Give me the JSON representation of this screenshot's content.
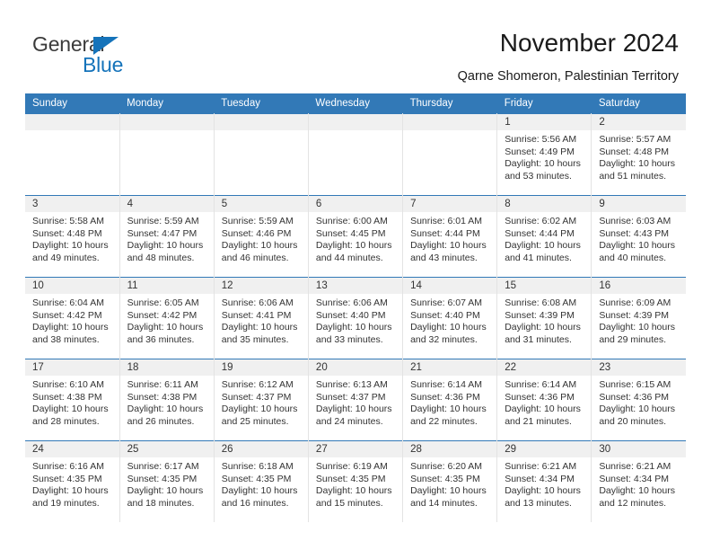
{
  "brand": {
    "name_top": "General",
    "name_bottom": "Blue",
    "accent_color": "#1573ba",
    "triangle_icon": "triangle-icon"
  },
  "header": {
    "title": "November 2024",
    "subtitle": "Qarne Shomeron, Palestinian Territory"
  },
  "calendar": {
    "header_bg": "#3279b7",
    "daynum_bg": "#f0f0f0",
    "weekday_headers": [
      "Sunday",
      "Monday",
      "Tuesday",
      "Wednesday",
      "Thursday",
      "Friday",
      "Saturday"
    ],
    "weeks": [
      [
        {
          "day": "",
          "empty": true
        },
        {
          "day": "",
          "empty": true
        },
        {
          "day": "",
          "empty": true
        },
        {
          "day": "",
          "empty": true
        },
        {
          "day": "",
          "empty": true
        },
        {
          "day": "1",
          "sunrise": "Sunrise: 5:56 AM",
          "sunset": "Sunset: 4:49 PM",
          "daylight1": "Daylight: 10 hours",
          "daylight2": "and 53 minutes."
        },
        {
          "day": "2",
          "sunrise": "Sunrise: 5:57 AM",
          "sunset": "Sunset: 4:48 PM",
          "daylight1": "Daylight: 10 hours",
          "daylight2": "and 51 minutes."
        }
      ],
      [
        {
          "day": "3",
          "sunrise": "Sunrise: 5:58 AM",
          "sunset": "Sunset: 4:48 PM",
          "daylight1": "Daylight: 10 hours",
          "daylight2": "and 49 minutes."
        },
        {
          "day": "4",
          "sunrise": "Sunrise: 5:59 AM",
          "sunset": "Sunset: 4:47 PM",
          "daylight1": "Daylight: 10 hours",
          "daylight2": "and 48 minutes."
        },
        {
          "day": "5",
          "sunrise": "Sunrise: 5:59 AM",
          "sunset": "Sunset: 4:46 PM",
          "daylight1": "Daylight: 10 hours",
          "daylight2": "and 46 minutes."
        },
        {
          "day": "6",
          "sunrise": "Sunrise: 6:00 AM",
          "sunset": "Sunset: 4:45 PM",
          "daylight1": "Daylight: 10 hours",
          "daylight2": "and 44 minutes."
        },
        {
          "day": "7",
          "sunrise": "Sunrise: 6:01 AM",
          "sunset": "Sunset: 4:44 PM",
          "daylight1": "Daylight: 10 hours",
          "daylight2": "and 43 minutes."
        },
        {
          "day": "8",
          "sunrise": "Sunrise: 6:02 AM",
          "sunset": "Sunset: 4:44 PM",
          "daylight1": "Daylight: 10 hours",
          "daylight2": "and 41 minutes."
        },
        {
          "day": "9",
          "sunrise": "Sunrise: 6:03 AM",
          "sunset": "Sunset: 4:43 PM",
          "daylight1": "Daylight: 10 hours",
          "daylight2": "and 40 minutes."
        }
      ],
      [
        {
          "day": "10",
          "sunrise": "Sunrise: 6:04 AM",
          "sunset": "Sunset: 4:42 PM",
          "daylight1": "Daylight: 10 hours",
          "daylight2": "and 38 minutes."
        },
        {
          "day": "11",
          "sunrise": "Sunrise: 6:05 AM",
          "sunset": "Sunset: 4:42 PM",
          "daylight1": "Daylight: 10 hours",
          "daylight2": "and 36 minutes."
        },
        {
          "day": "12",
          "sunrise": "Sunrise: 6:06 AM",
          "sunset": "Sunset: 4:41 PM",
          "daylight1": "Daylight: 10 hours",
          "daylight2": "and 35 minutes."
        },
        {
          "day": "13",
          "sunrise": "Sunrise: 6:06 AM",
          "sunset": "Sunset: 4:40 PM",
          "daylight1": "Daylight: 10 hours",
          "daylight2": "and 33 minutes."
        },
        {
          "day": "14",
          "sunrise": "Sunrise: 6:07 AM",
          "sunset": "Sunset: 4:40 PM",
          "daylight1": "Daylight: 10 hours",
          "daylight2": "and 32 minutes."
        },
        {
          "day": "15",
          "sunrise": "Sunrise: 6:08 AM",
          "sunset": "Sunset: 4:39 PM",
          "daylight1": "Daylight: 10 hours",
          "daylight2": "and 31 minutes."
        },
        {
          "day": "16",
          "sunrise": "Sunrise: 6:09 AM",
          "sunset": "Sunset: 4:39 PM",
          "daylight1": "Daylight: 10 hours",
          "daylight2": "and 29 minutes."
        }
      ],
      [
        {
          "day": "17",
          "sunrise": "Sunrise: 6:10 AM",
          "sunset": "Sunset: 4:38 PM",
          "daylight1": "Daylight: 10 hours",
          "daylight2": "and 28 minutes."
        },
        {
          "day": "18",
          "sunrise": "Sunrise: 6:11 AM",
          "sunset": "Sunset: 4:38 PM",
          "daylight1": "Daylight: 10 hours",
          "daylight2": "and 26 minutes."
        },
        {
          "day": "19",
          "sunrise": "Sunrise: 6:12 AM",
          "sunset": "Sunset: 4:37 PM",
          "daylight1": "Daylight: 10 hours",
          "daylight2": "and 25 minutes."
        },
        {
          "day": "20",
          "sunrise": "Sunrise: 6:13 AM",
          "sunset": "Sunset: 4:37 PM",
          "daylight1": "Daylight: 10 hours",
          "daylight2": "and 24 minutes."
        },
        {
          "day": "21",
          "sunrise": "Sunrise: 6:14 AM",
          "sunset": "Sunset: 4:36 PM",
          "daylight1": "Daylight: 10 hours",
          "daylight2": "and 22 minutes."
        },
        {
          "day": "22",
          "sunrise": "Sunrise: 6:14 AM",
          "sunset": "Sunset: 4:36 PM",
          "daylight1": "Daylight: 10 hours",
          "daylight2": "and 21 minutes."
        },
        {
          "day": "23",
          "sunrise": "Sunrise: 6:15 AM",
          "sunset": "Sunset: 4:36 PM",
          "daylight1": "Daylight: 10 hours",
          "daylight2": "and 20 minutes."
        }
      ],
      [
        {
          "day": "24",
          "sunrise": "Sunrise: 6:16 AM",
          "sunset": "Sunset: 4:35 PM",
          "daylight1": "Daylight: 10 hours",
          "daylight2": "and 19 minutes."
        },
        {
          "day": "25",
          "sunrise": "Sunrise: 6:17 AM",
          "sunset": "Sunset: 4:35 PM",
          "daylight1": "Daylight: 10 hours",
          "daylight2": "and 18 minutes."
        },
        {
          "day": "26",
          "sunrise": "Sunrise: 6:18 AM",
          "sunset": "Sunset: 4:35 PM",
          "daylight1": "Daylight: 10 hours",
          "daylight2": "and 16 minutes."
        },
        {
          "day": "27",
          "sunrise": "Sunrise: 6:19 AM",
          "sunset": "Sunset: 4:35 PM",
          "daylight1": "Daylight: 10 hours",
          "daylight2": "and 15 minutes."
        },
        {
          "day": "28",
          "sunrise": "Sunrise: 6:20 AM",
          "sunset": "Sunset: 4:35 PM",
          "daylight1": "Daylight: 10 hours",
          "daylight2": "and 14 minutes."
        },
        {
          "day": "29",
          "sunrise": "Sunrise: 6:21 AM",
          "sunset": "Sunset: 4:34 PM",
          "daylight1": "Daylight: 10 hours",
          "daylight2": "and 13 minutes."
        },
        {
          "day": "30",
          "sunrise": "Sunrise: 6:21 AM",
          "sunset": "Sunset: 4:34 PM",
          "daylight1": "Daylight: 10 hours",
          "daylight2": "and 12 minutes."
        }
      ]
    ]
  }
}
